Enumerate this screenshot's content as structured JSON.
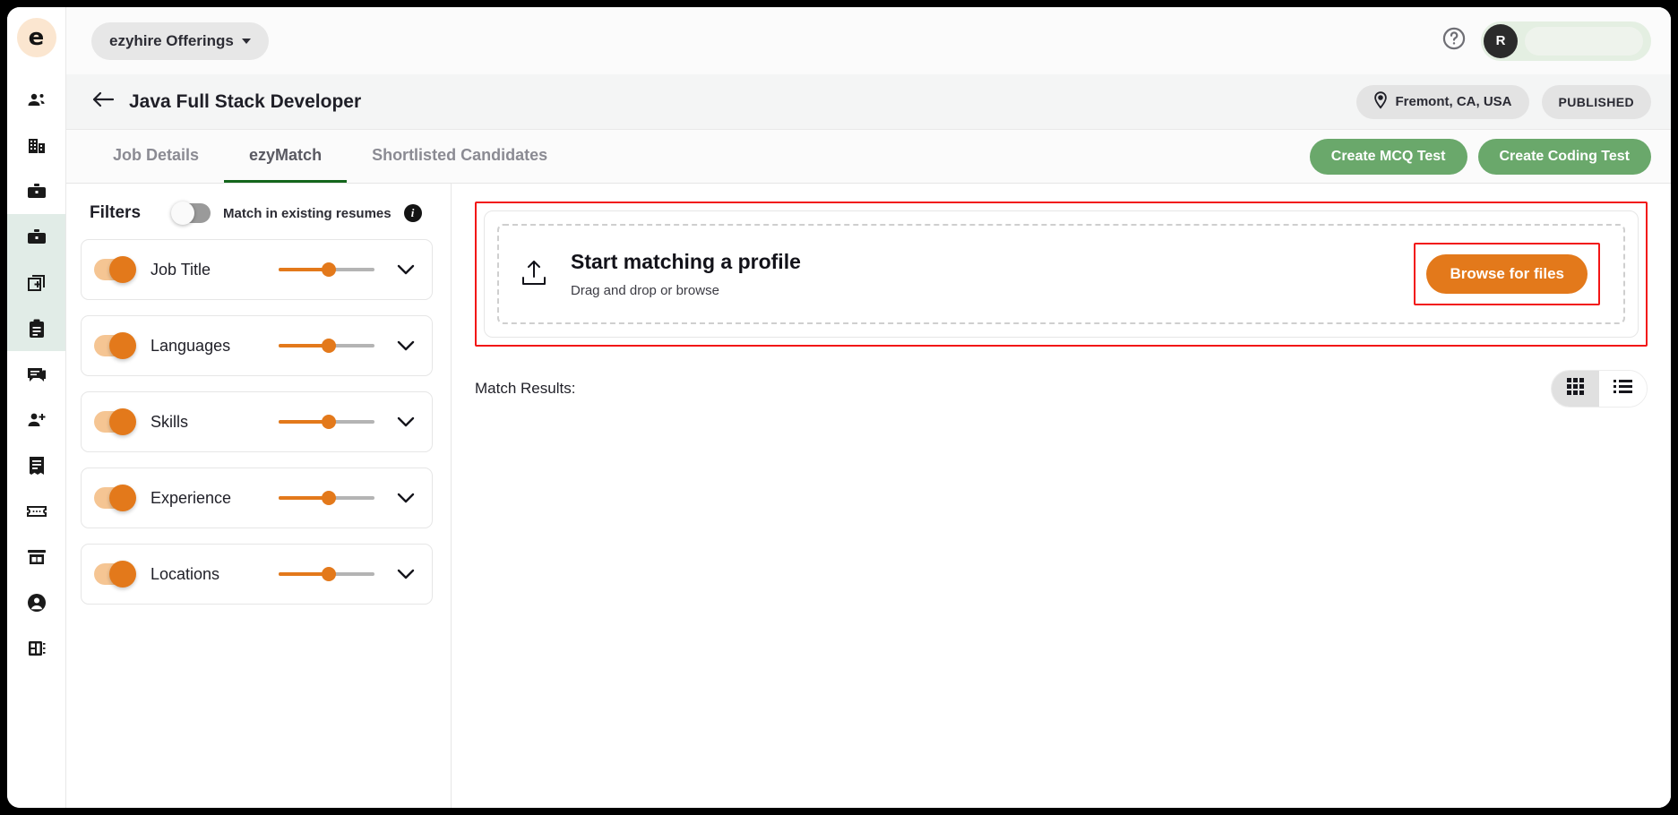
{
  "sidebar": {
    "logo_letter": "e",
    "items": [
      {
        "icon": "people-icon",
        "name": "candidates",
        "highlight": false
      },
      {
        "icon": "building-icon",
        "name": "companies",
        "highlight": false
      },
      {
        "icon": "briefcase-icon",
        "name": "jobs",
        "highlight": false
      },
      {
        "icon": "briefcase-alt-icon",
        "name": "job-offerings",
        "highlight": true
      },
      {
        "icon": "add-copy-icon",
        "name": "create-job",
        "highlight": true
      },
      {
        "icon": "clipboard-icon",
        "name": "applications",
        "highlight": true
      },
      {
        "icon": "chat-icon",
        "name": "messages",
        "highlight": false
      },
      {
        "icon": "add-person-icon",
        "name": "add-candidate",
        "highlight": false
      },
      {
        "icon": "invoice-icon",
        "name": "invoices",
        "highlight": false
      },
      {
        "icon": "ticket-icon",
        "name": "tickets",
        "highlight": false
      },
      {
        "icon": "store-icon",
        "name": "marketplace",
        "highlight": false
      },
      {
        "icon": "account-icon",
        "name": "account",
        "highlight": false
      },
      {
        "icon": "dashboard-icon",
        "name": "dashboard",
        "highlight": false
      }
    ]
  },
  "topbar": {
    "offerings_label": "ezyhire Offerings",
    "help_icon": "help-circle-icon",
    "avatar_initial": "R"
  },
  "job_header": {
    "back_icon": "arrow-left-icon",
    "title": "Java Full Stack Developer",
    "location_icon": "location-pin-icon",
    "location": "Fremont, CA, USA",
    "status": "PUBLISHED"
  },
  "tabs": [
    {
      "label": "Job Details",
      "active": false
    },
    {
      "label": "ezyMatch",
      "active": true
    },
    {
      "label": "Shortlisted Candidates",
      "active": false
    }
  ],
  "tab_actions": {
    "mcq_test": "Create MCQ Test",
    "coding_test": "Create Coding Test"
  },
  "filters": {
    "title": "Filters",
    "match_existing_label": "Match in existing resumes",
    "match_existing_enabled": "off",
    "info_icon": "info-icon",
    "items": [
      {
        "label": "Job Title",
        "enabled": "on",
        "weight": 52
      },
      {
        "label": "Languages",
        "enabled": "on",
        "weight": 52
      },
      {
        "label": "Skills",
        "enabled": "on",
        "weight": 52
      },
      {
        "label": "Experience",
        "enabled": "on",
        "weight": 52
      },
      {
        "label": "Locations",
        "enabled": "on",
        "weight": 52
      }
    ]
  },
  "upload": {
    "icon": "upload-icon",
    "title": "Start matching a profile",
    "subtitle": "Drag and drop or browse",
    "browse_label": "Browse for files"
  },
  "results": {
    "label": "Match Results:",
    "grid_icon": "grid-view-icon",
    "list_icon": "list-view-icon",
    "active_view": "grid"
  },
  "colors": {
    "accent_orange": "#e3791b",
    "accent_green": "#6aa86b",
    "tab_underline_green": "#14661c",
    "annotation_red": "#f21616",
    "sidebar_highlight": "#e1ece7"
  }
}
